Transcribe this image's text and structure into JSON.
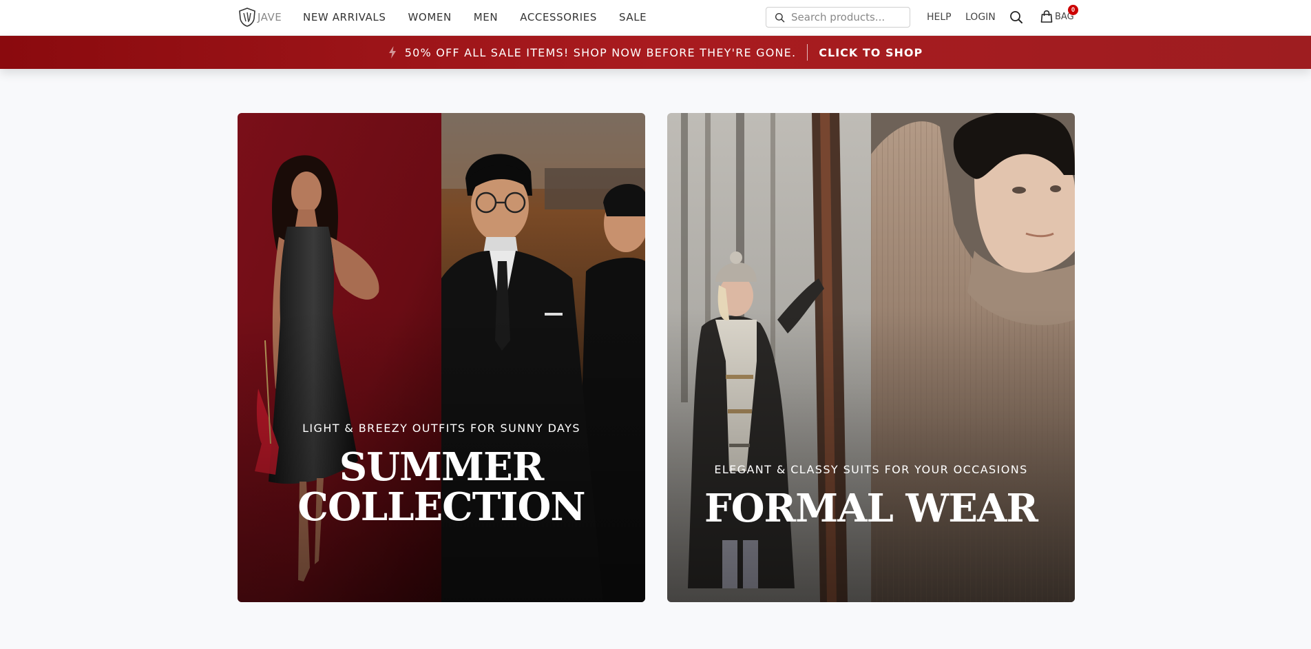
{
  "brand": {
    "name": "JAVE"
  },
  "nav": {
    "items": [
      {
        "label": "NEW ARRIVALS"
      },
      {
        "label": "WOMEN"
      },
      {
        "label": "MEN"
      },
      {
        "label": "ACCESSORIES"
      },
      {
        "label": "SALE"
      }
    ]
  },
  "search": {
    "placeholder": "Search products..."
  },
  "header": {
    "help_label": "HELP",
    "login_label": "LOGIN",
    "bag_label": "BAG",
    "bag_count": "0"
  },
  "promo": {
    "text": "50% OFF ALL SALE ITEMS! SHOP NOW BEFORE THEY'RE GONE.",
    "cta": "CLICK TO SHOP",
    "icon": "bolt-icon"
  },
  "cards": [
    {
      "subtitle": "LIGHT & BREEZY OUTFITS FOR SUNNY DAYS",
      "title_line1": "SUMMER",
      "title_line2": "COLLECTION"
    },
    {
      "subtitle": "ELEGANT & CLASSY SUITS FOR YOUR OCCASIONS",
      "title_line1": "FORMAL WEAR"
    }
  ],
  "colors": {
    "promo_bg": "#9e1518",
    "badge": "#cc0000",
    "page_bg": "#f8f9fb"
  }
}
